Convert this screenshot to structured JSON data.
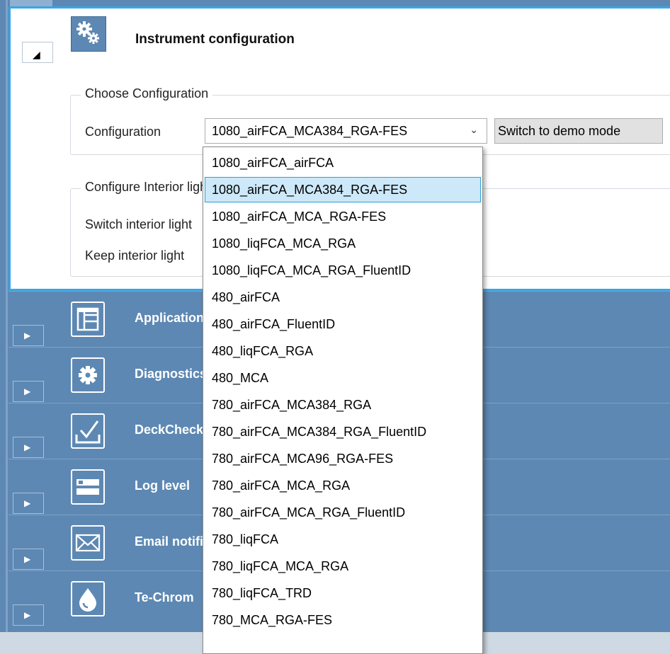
{
  "panel": {
    "title": "Instrument configuration",
    "toggle_glyph": "◢"
  },
  "choose_group": {
    "legend": "Choose Configuration",
    "config_label": "Configuration",
    "config_value": "1080_airFCA_MCA384_RGA-FES",
    "switch_button": "Switch to demo mode"
  },
  "interior_group": {
    "legend": "Configure Interior light",
    "switch_label": "Switch interior light",
    "keep_label": "Keep interior light"
  },
  "sections": [
    {
      "title": "Application settings",
      "icon": "application-icon"
    },
    {
      "title": "Diagnostics",
      "icon": "gear-icon"
    },
    {
      "title": "DeckCheck",
      "icon": "checkbox-icon"
    },
    {
      "title": "Log level",
      "icon": "log-level-icon"
    },
    {
      "title": "Email notifications",
      "icon": "envelope-icon"
    },
    {
      "title": "Te-Chrom",
      "icon": "drop-icon"
    }
  ],
  "dropdown": {
    "selected_index": 1,
    "options": [
      "1080_airFCA_airFCA",
      "1080_airFCA_MCA384_RGA-FES",
      "1080_airFCA_MCA_RGA-FES",
      "1080_liqFCA_MCA_RGA",
      "1080_liqFCA_MCA_RGA_FluentID",
      "480_airFCA",
      "480_airFCA_FluentID",
      "480_liqFCA_RGA",
      "480_MCA",
      "780_airFCA_MCA384_RGA",
      "780_airFCA_MCA384_RGA_FluentID",
      "780_airFCA_MCA96_RGA-FES",
      "780_airFCA_MCA_RGA",
      "780_airFCA_MCA_RGA_FluentID",
      "780_liqFCA",
      "780_liqFCA_MCA_RGA",
      "780_liqFCA_TRD",
      "780_MCA_RGA-FES"
    ]
  },
  "colors": {
    "section_bg": "#5d88b3",
    "focus_border": "#37a6e6",
    "selected_item_bg": "#cde8f8"
  }
}
